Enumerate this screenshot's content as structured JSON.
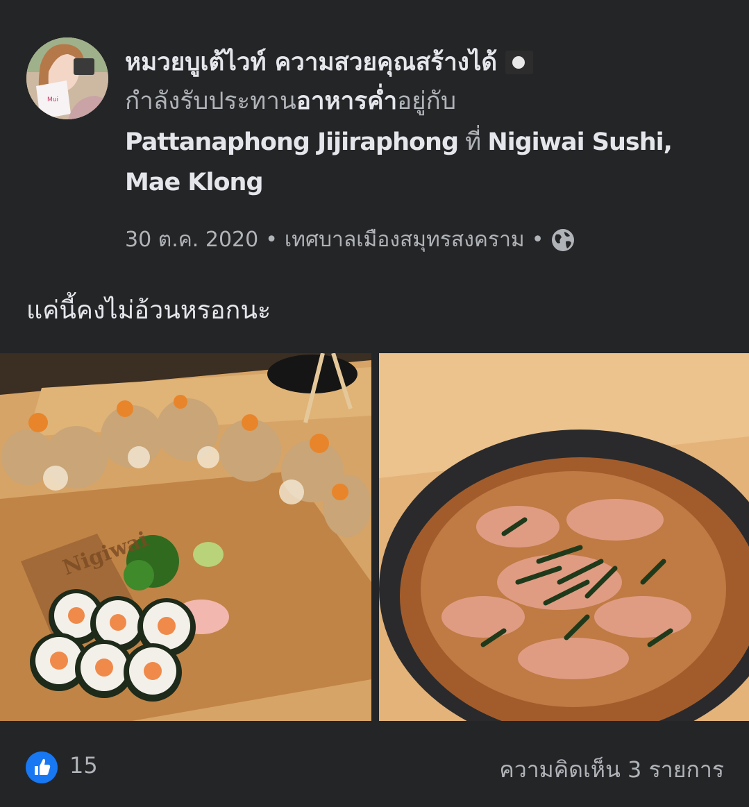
{
  "post": {
    "author_name": "หมวยบูเต้ไวท์ ความสวยคุณสร้างได้",
    "activity_prefix": "กำลังรับประทาน",
    "activity_bold": "อาหารค่ำ",
    "activity_suffix": "อยู่กับ",
    "tagged_person": "Pattanaphong Jijiraphong",
    "at_word": " ที่ ",
    "place_line1": "Nigiwai Sushi,",
    "place_line2": "Mae Klong",
    "date": "30 ต.ค. 2020",
    "separator": "•",
    "location": "เทศบาลเมืองสมุทรสงคราม",
    "caption": "แค่นี้คงไม่อ้วนหรอกนะ",
    "photo_left_logo": "Nigiwai"
  },
  "footer": {
    "like_count": "15",
    "comments_label": "ความคิดเห็น 3 รายการ"
  },
  "colors": {
    "background": "#242526",
    "primary_text": "#e4e6eb",
    "secondary_text": "#b0b3b8",
    "like_blue": "#1877f2"
  },
  "icons": {
    "privacy": "globe-icon",
    "reaction": "like-thumb-icon",
    "status": "emoji-icon"
  }
}
